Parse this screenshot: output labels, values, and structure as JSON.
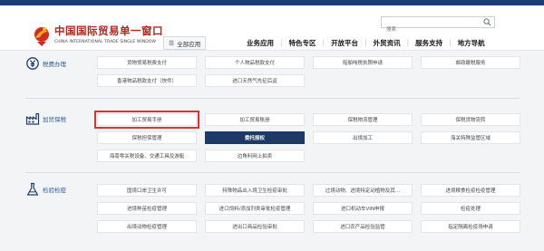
{
  "header": {
    "logo_cn": "中国国际贸易单一窗口",
    "logo_en": "CHINA INTERNATIONAL TRADE SINGLE WINDOW",
    "all_apps_label": "全部应用",
    "search_placeholder": "搜索",
    "nav": [
      "业务应用",
      "特色专区",
      "开放平台",
      "外贸资讯",
      "服务支持",
      "地方导航"
    ]
  },
  "categories": [
    {
      "name": "税费办理",
      "icon": "yen-circle-icon",
      "rows": [
        [
          "货物贸易税费支付",
          "个人物品税款支付",
          "船舶吨税执照申请",
          "邮政缴税服务"
        ],
        [
          "",
          "香港物品税款支付（快件）",
          "进口天然气先征后返",
          ""
        ]
      ]
    },
    {
      "name": "加贸保税",
      "icon": "factory-icon",
      "rows": [
        [
          "加工贸易手册",
          "加工贸易账册",
          "保税物流管理",
          "保税货物流转"
        ],
        [
          "保税担保管理",
          "委托授权",
          "出境加工",
          "海关特殊监管区域"
        ],
        [
          "海南零关税设备、交通工具及游艇",
          "边角料网上拍卖",
          "",
          ""
        ]
      ]
    },
    {
      "name": "检验检疫",
      "icon": "flask-icon",
      "rows": [
        [
          "国境口岸卫生许可",
          "特殊物品出入境卫生检疫审批",
          "过境动物、进境特定动植物及其…",
          "进境粮食检疫检疫管理"
        ],
        [
          "进境种苗检疫管理",
          "进口饲料/添加剂类审批检疫管理",
          "进口机动车VIN申报",
          "检疫处理"
        ],
        [
          "出境动物检疫管理",
          "进出口商品检验审批",
          "进口农产品检验监管",
          "指定隔离检疫场申请"
        ]
      ]
    }
  ],
  "highlighted_item": "加工贸易手册",
  "active_item": "委托授权",
  "colors": {
    "topbar": "#1b3f73",
    "accent_red": "#b3261e",
    "active_cell": "#1c3a63",
    "category_label": "#2a5aa0",
    "highlight_outline": "#e0322b"
  }
}
